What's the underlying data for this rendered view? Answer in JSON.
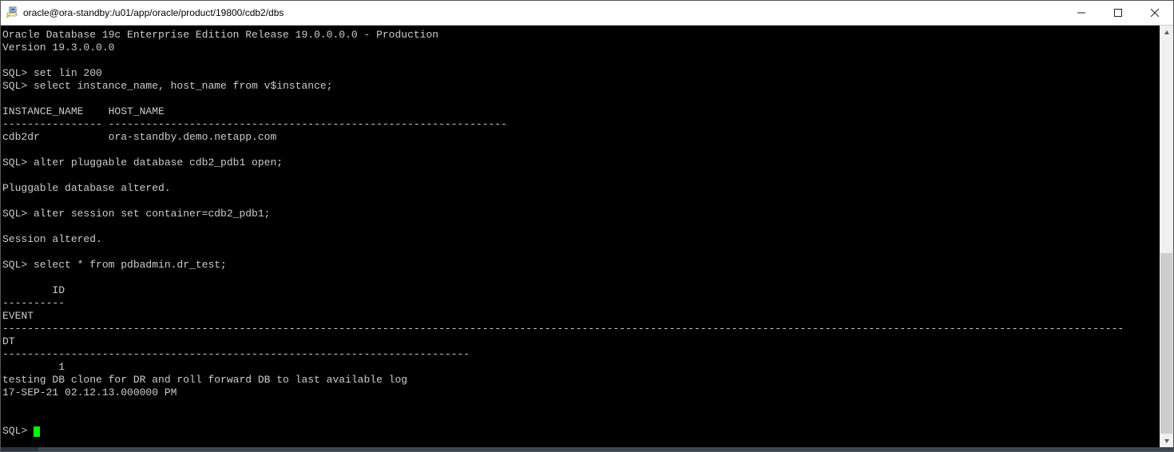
{
  "window": {
    "title": "oracle@ora-standby:/u01/app/oracle/product/19800/cdb2/dbs"
  },
  "terminal": {
    "lines": [
      "Oracle Database 19c Enterprise Edition Release 19.0.0.0.0 - Production",
      "Version 19.3.0.0.0",
      "",
      "SQL> set lin 200",
      "SQL> select instance_name, host_name from v$instance;",
      "",
      "INSTANCE_NAME    HOST_NAME",
      "---------------- ----------------------------------------------------------------",
      "cdb2dr           ora-standby.demo.netapp.com",
      "",
      "SQL> alter pluggable database cdb2_pdb1 open;",
      "",
      "Pluggable database altered.",
      "",
      "SQL> alter session set container=cdb2_pdb1;",
      "",
      "Session altered.",
      "",
      "SQL> select * from pdbadmin.dr_test;",
      "",
      "        ID",
      "----------",
      "EVENT",
      "------------------------------------------------------------------------------------------------------------------------------------------------------------------------------------",
      "DT",
      "---------------------------------------------------------------------------",
      "         1",
      "testing DB clone for DR and roll forward DB to last available log",
      "17-SEP-21 02.12.13.000000 PM",
      "",
      ""
    ],
    "prompt": "SQL> "
  },
  "scrollbar": {
    "thumb_top_percent": 54,
    "thumb_height_percent": 44
  }
}
